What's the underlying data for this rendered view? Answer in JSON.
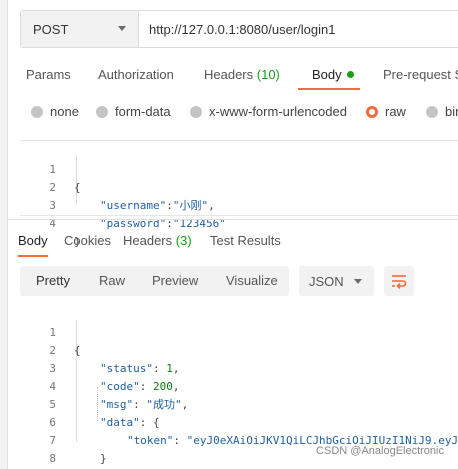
{
  "request": {
    "method": "POST",
    "url": "http://127.0.0.1:8080/user/login1"
  },
  "request_tabs": [
    {
      "label": "Params"
    },
    {
      "label": "Authorization"
    },
    {
      "label": "Headers",
      "count": "(10)"
    },
    {
      "label": "Body",
      "active": true
    },
    {
      "label": "Pre-request S"
    }
  ],
  "body_types": [
    {
      "label": "none",
      "selected": false
    },
    {
      "label": "form-data",
      "selected": false
    },
    {
      "label": "x-www-form-urlencoded",
      "selected": false
    },
    {
      "label": "raw",
      "selected": true
    },
    {
      "label": "bin",
      "selected": false
    }
  ],
  "request_body": {
    "line_numbers": [
      "1",
      "2",
      "3",
      "4"
    ],
    "username_key": "\"username\"",
    "username_value": "\"小刚\"",
    "password_key": "\"password\"",
    "password_value": "\"123456\""
  },
  "response_tabs": [
    {
      "label": "Body",
      "active": true
    },
    {
      "label": "Cookies"
    },
    {
      "label": "Headers",
      "count": "(3)"
    },
    {
      "label": "Test Results"
    }
  ],
  "response_toolbar": {
    "views": [
      "Pretty",
      "Raw",
      "Preview",
      "Visualize"
    ],
    "format": "JSON",
    "wrap_icon": "wrap-lines-icon"
  },
  "response_body": {
    "line_numbers": [
      "1",
      "2",
      "3",
      "4",
      "5",
      "6",
      "7",
      "8"
    ],
    "status_key": "\"status\"",
    "status_value": "1",
    "code_key": "\"code\"",
    "code_value": "200",
    "msg_key": "\"msg\"",
    "msg_value": "\"成功\"",
    "data_key": "\"data\"",
    "token_key": "\"token\"",
    "token_value": "\"eyJ0eXAiOiJKV1QiLCJhbGciOiJIUzI1NiJ9.eyJ"
  },
  "watermark": "CSDN @AnalogElectronic",
  "colors": {
    "accent": "#f26b3a",
    "count_green": "#16a116",
    "json_key": "#1f5fa5",
    "json_number": "#0c7a0c"
  }
}
